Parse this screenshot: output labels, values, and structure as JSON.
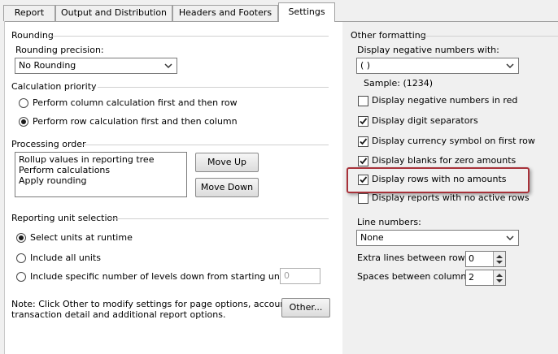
{
  "tabs": [
    "Report",
    "Output and Distribution",
    "Headers and Footers",
    "Settings"
  ],
  "left": {
    "rounding": {
      "title": "Rounding",
      "precision_label": "Rounding precision:",
      "precision_value": "No Rounding"
    },
    "calc_priority": {
      "title": "Calculation priority",
      "options": [
        "Perform column calculation first and then row",
        "Perform row calculation first and then column"
      ],
      "selected_index": 1
    },
    "processing": {
      "title": "Processing order",
      "items": [
        "Rollup values in reporting tree",
        "Perform calculations",
        "Apply rounding"
      ],
      "move_up": "Move Up",
      "move_down": "Move Down"
    },
    "reporting_unit": {
      "title": "Reporting unit selection",
      "options": [
        "Select units at runtime",
        "Include all units",
        "Include specific number of levels down from starting unit:"
      ],
      "selected_index": 0,
      "levels_value": "0"
    },
    "note": {
      "line1": "Note: Click Other to modify settings for page options, account and",
      "line2": "transaction detail and additional report options.",
      "other_button": "Other..."
    }
  },
  "right": {
    "title": "Other formatting",
    "negative_label": "Display negative numbers with:",
    "negative_value": "( )",
    "sample": "Sample: (1234)",
    "checks": [
      {
        "label": "Display negative numbers in red",
        "checked": false
      },
      {
        "label": "Display digit separators",
        "checked": true
      },
      {
        "label": "Display currency symbol on first row",
        "checked": true
      },
      {
        "label": "Display blanks for zero amounts",
        "checked": true
      },
      {
        "label": "Display rows with no amounts",
        "checked": true
      },
      {
        "label": "Display reports with no active rows",
        "checked": false
      }
    ],
    "line_numbers_label": "Line numbers:",
    "line_numbers_value": "None",
    "extra_lines_label": "Extra lines between rows:",
    "extra_lines_value": "0",
    "spaces_label": "Spaces between columns:",
    "spaces_value": "2"
  },
  "colors": {
    "highlight_border": "#a8323a",
    "panel_gray": "#f0f0f0"
  }
}
